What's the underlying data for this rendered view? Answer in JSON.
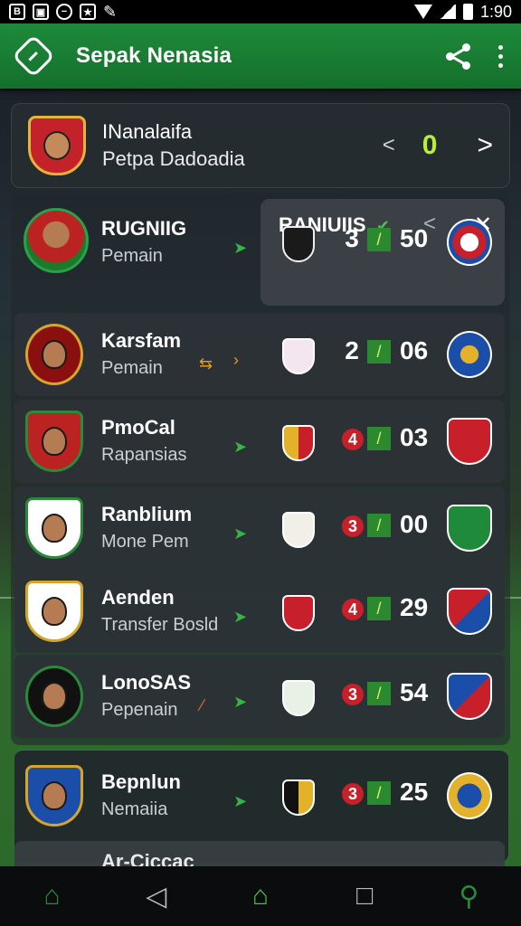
{
  "status_bar": {
    "time": "1:90",
    "left_icons": [
      "b-icon",
      "image-icon",
      "circle-icon",
      "badge-icon",
      "tool-icon"
    ]
  },
  "app_bar": {
    "title": "Sepak Nenasia"
  },
  "top_card": {
    "line1": "INanalaifa",
    "line2": "Petpa Dadoadia",
    "prev": "<",
    "score": "0",
    "next": ">"
  },
  "ranking": {
    "title": "RANIUIIS",
    "check": "✔",
    "prev": "<",
    "close": "✕"
  },
  "players": [
    {
      "name": "RUGNIIG",
      "role": "Pemain",
      "home_score": "3",
      "away_score": "50",
      "home_badge": false
    },
    {
      "name": "Karsfam",
      "role": "Pemain",
      "home_score": "2",
      "away_score": "06",
      "home_badge": false
    },
    {
      "name": "PmoCal",
      "role": "Rapansias",
      "home_score": "4",
      "away_score": "03",
      "home_badge": true
    },
    {
      "name": "Ranblium",
      "role": "Mone Pem",
      "home_score": "3",
      "away_score": "00",
      "home_badge": true
    },
    {
      "name": "Aenden",
      "role": "Transfer Bosld",
      "home_score": "4",
      "away_score": "29",
      "home_badge": true
    },
    {
      "name": "LonoSAS",
      "role": "Pepenain",
      "home_score": "3",
      "away_score": "54",
      "home_badge": true
    },
    {
      "name": "Bepnlun",
      "role": "Nemaiia",
      "home_score": "3",
      "away_score": "25",
      "home_badge": true
    }
  ],
  "peek_row": {
    "name": "Ar-Ciccac"
  },
  "colors": {
    "accent": "#1e8a3a",
    "score_green": "#b9f033",
    "red_badge": "#c8202a"
  }
}
